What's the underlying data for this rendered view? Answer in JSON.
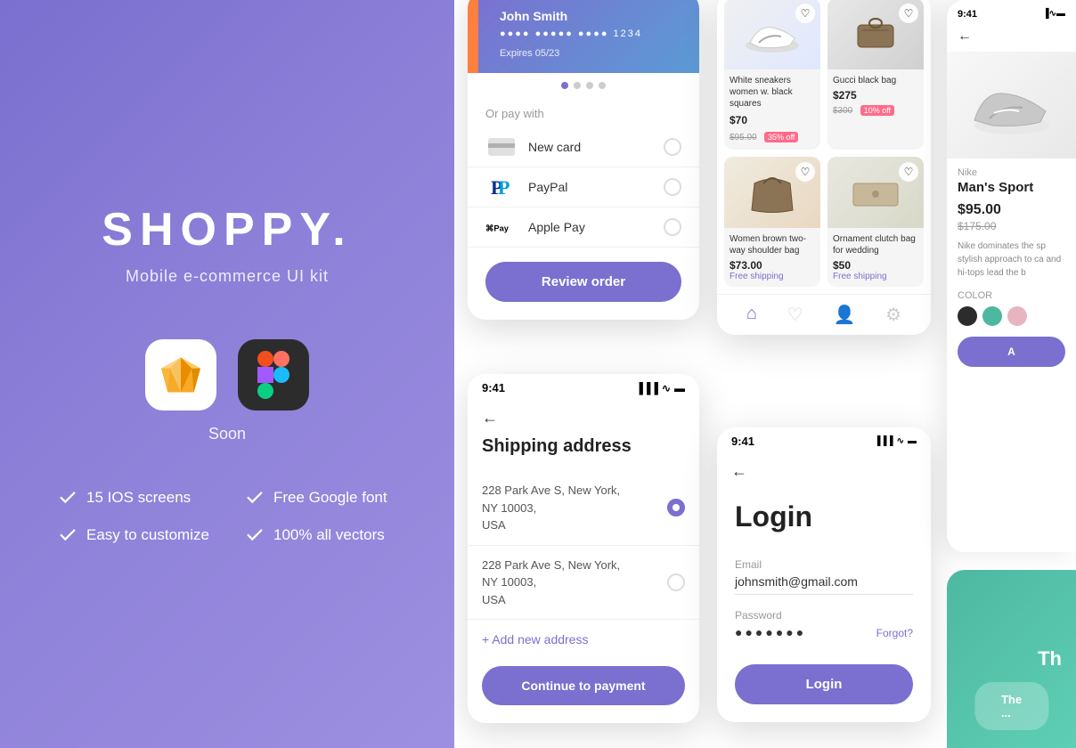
{
  "brand": {
    "name": "SHOPPY.",
    "subtitle": "Mobile e-commerce UI kit"
  },
  "features": [
    {
      "id": "ios-screens",
      "text": "15 IOS screens"
    },
    {
      "id": "google-font",
      "text": "Free Google font"
    },
    {
      "id": "customize",
      "text": "Easy to customize"
    },
    {
      "id": "vectors",
      "text": "100% all vectors"
    }
  ],
  "soon_label": "Soon",
  "payment_screen": {
    "card_name": "John Smith",
    "card_number": "●●●●  ●●●●●  ●●●● 1234",
    "card_expiry": "Expires 05/23",
    "pay_with_label": "Or pay with",
    "options": [
      {
        "id": "new-card",
        "label": "New card"
      },
      {
        "id": "paypal",
        "label": "PayPal"
      },
      {
        "id": "apple-pay",
        "label": "Apple Pay"
      }
    ],
    "review_btn": "Review order"
  },
  "shipping_screen": {
    "time": "9:41",
    "title": "Shipping address",
    "addresses": [
      {
        "line1": "228 Park Ave S, New York,",
        "line2": "NY 10003,",
        "line3": "USA",
        "selected": true
      },
      {
        "line1": "228 Park Ave S, New York,",
        "line2": "NY 10003,",
        "line3": "USA",
        "selected": false
      }
    ],
    "add_address": "+ Add new address",
    "continue_btn": "Continue to payment"
  },
  "products_screen": {
    "products": [
      {
        "id": "sneakers",
        "name": "White sneakers women w. black squares",
        "price": "$70",
        "old_price": "$95.00",
        "discount": "35% off",
        "img_class": "img-sneaker"
      },
      {
        "id": "gucci-bag",
        "name": "Gucci black bag",
        "price": "$275",
        "old_price": "$300",
        "discount": "10% off",
        "img_class": "img-glasses"
      },
      {
        "id": "brown-bag",
        "name": "Women brown two-way shoulder bag",
        "price": "$73.00",
        "free_shipping": "Free shipping",
        "img_class": "img-bag"
      },
      {
        "id": "clutch",
        "name": "Ornament clutch bag for wedding",
        "price": "$50",
        "free_shipping": "Free shipping",
        "img_class": "img-clutch"
      }
    ]
  },
  "login_screen": {
    "time": "9:41",
    "title": "Login",
    "email_label": "Email",
    "email_value": "johnsmith@gmail.com",
    "password_label": "Password",
    "password_value": "●●●●●●●",
    "forgot_label": "Forgot?",
    "login_btn": "Login"
  },
  "detail_screen": {
    "time": "9:41",
    "brand": "Nike",
    "product_name": "Man's Sport",
    "price": "$95.00",
    "old_price": "$175.00",
    "description": "Nike dominates the sp stylish approach to ca and hi-tops lead the b",
    "color_label": "COLOR",
    "add_btn": "A",
    "swatches": [
      "#2c2c2c",
      "#4db8a0",
      "#e8b4c0"
    ]
  },
  "teal_screen": {
    "text": "Th"
  }
}
